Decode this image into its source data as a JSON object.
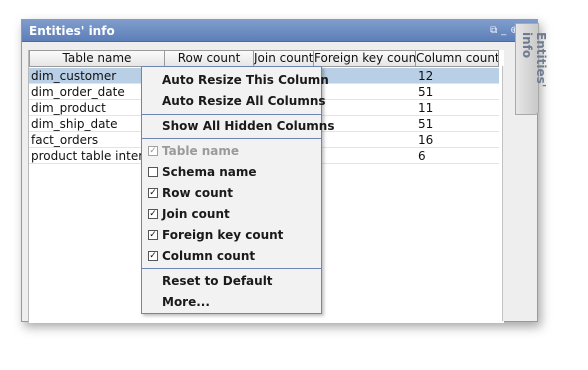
{
  "panel": {
    "title": "Entities' info",
    "side_tab": "Entities' info"
  },
  "table": {
    "headers": [
      "Table name",
      "Row count",
      "Join count",
      "Foreign key count",
      "Column count"
    ],
    "rows": [
      {
        "name": "dim_customer",
        "column_count": "12",
        "selected": true
      },
      {
        "name": "dim_order_date",
        "column_count": "51"
      },
      {
        "name": "dim_product",
        "column_count": "11"
      },
      {
        "name": "dim_ship_date",
        "column_count": "51"
      },
      {
        "name": "fact_orders",
        "column_count": "16"
      },
      {
        "name": "product table intervie",
        "column_count": "6"
      }
    ]
  },
  "menu": {
    "auto_resize_this": "Auto Resize This Column",
    "auto_resize_all": "Auto Resize All Columns",
    "show_hidden": "Show All Hidden Columns",
    "columns": [
      {
        "label": "Table name",
        "checked": true,
        "disabled": true
      },
      {
        "label": "Schema name",
        "checked": false,
        "disabled": false
      },
      {
        "label": "Row count",
        "checked": true,
        "disabled": false
      },
      {
        "label": "Join count",
        "checked": true,
        "disabled": false
      },
      {
        "label": "Foreign key count",
        "checked": true,
        "disabled": false
      },
      {
        "label": "Column count",
        "checked": true,
        "disabled": false
      }
    ],
    "reset": "Reset to Default",
    "more": "More..."
  }
}
